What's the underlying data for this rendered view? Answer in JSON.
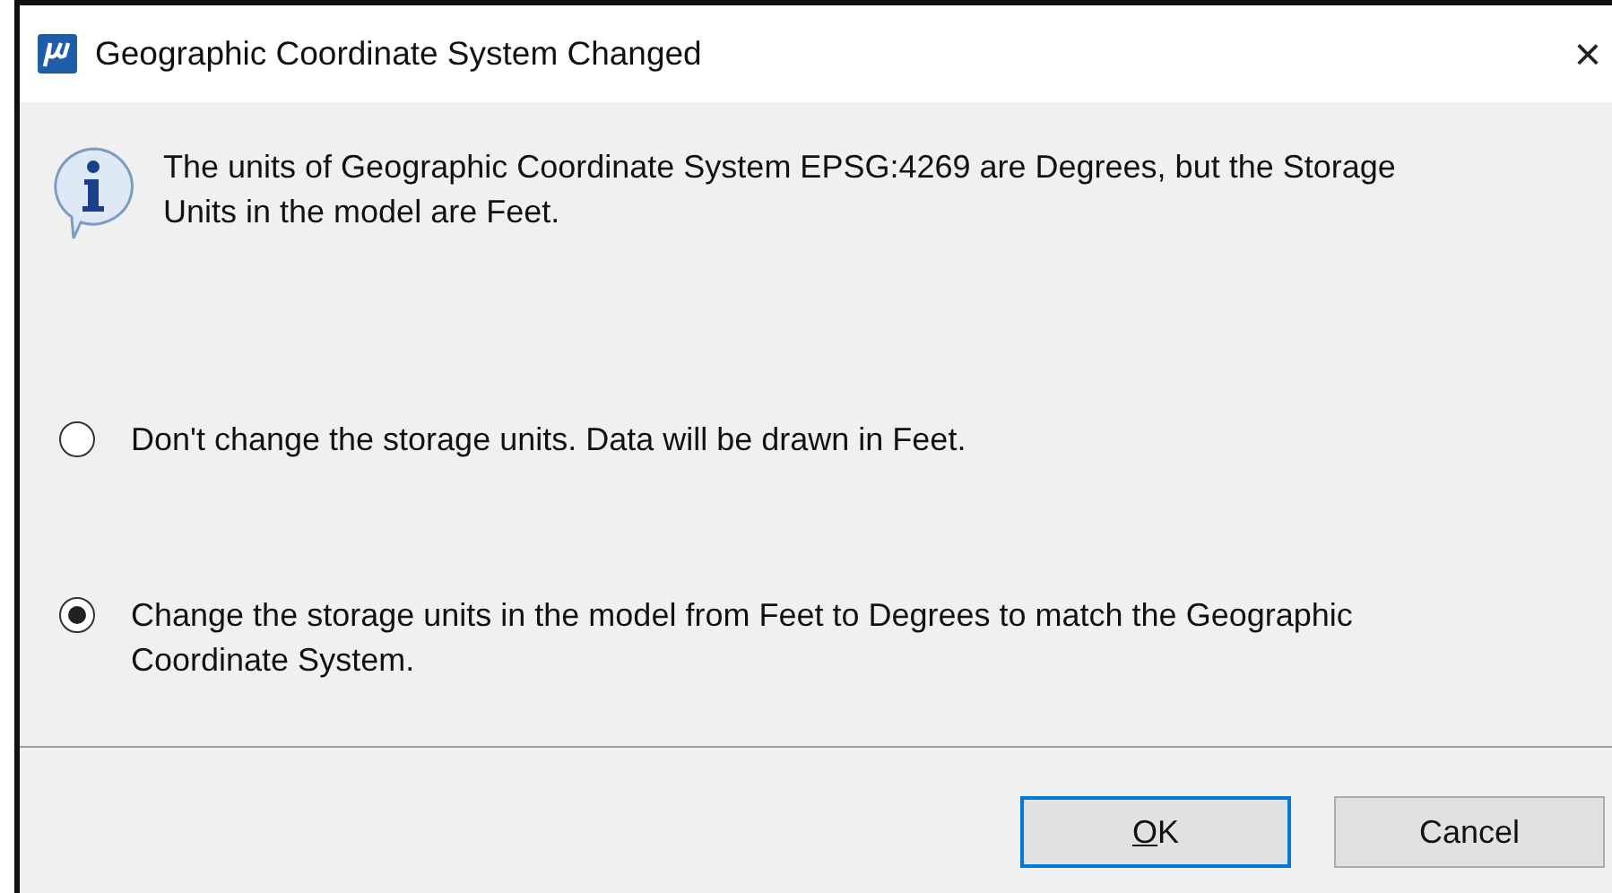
{
  "window": {
    "title": "Geographic Coordinate System Changed",
    "close": "×"
  },
  "message": "The units of Geographic Coordinate System EPSG:4269 are Degrees, but the Storage Units in the model are Feet.",
  "options": [
    {
      "label": "Don't change the storage units. Data will be drawn in Feet.",
      "selected": false
    },
    {
      "label": "Change the storage units in the model from Feet to Degrees to match the Geographic Coordinate System.",
      "selected": true
    }
  ],
  "buttons": [
    {
      "label": "OK",
      "access_key_underlined": true,
      "default": true
    },
    {
      "label": "Cancel",
      "default": false
    }
  ]
}
